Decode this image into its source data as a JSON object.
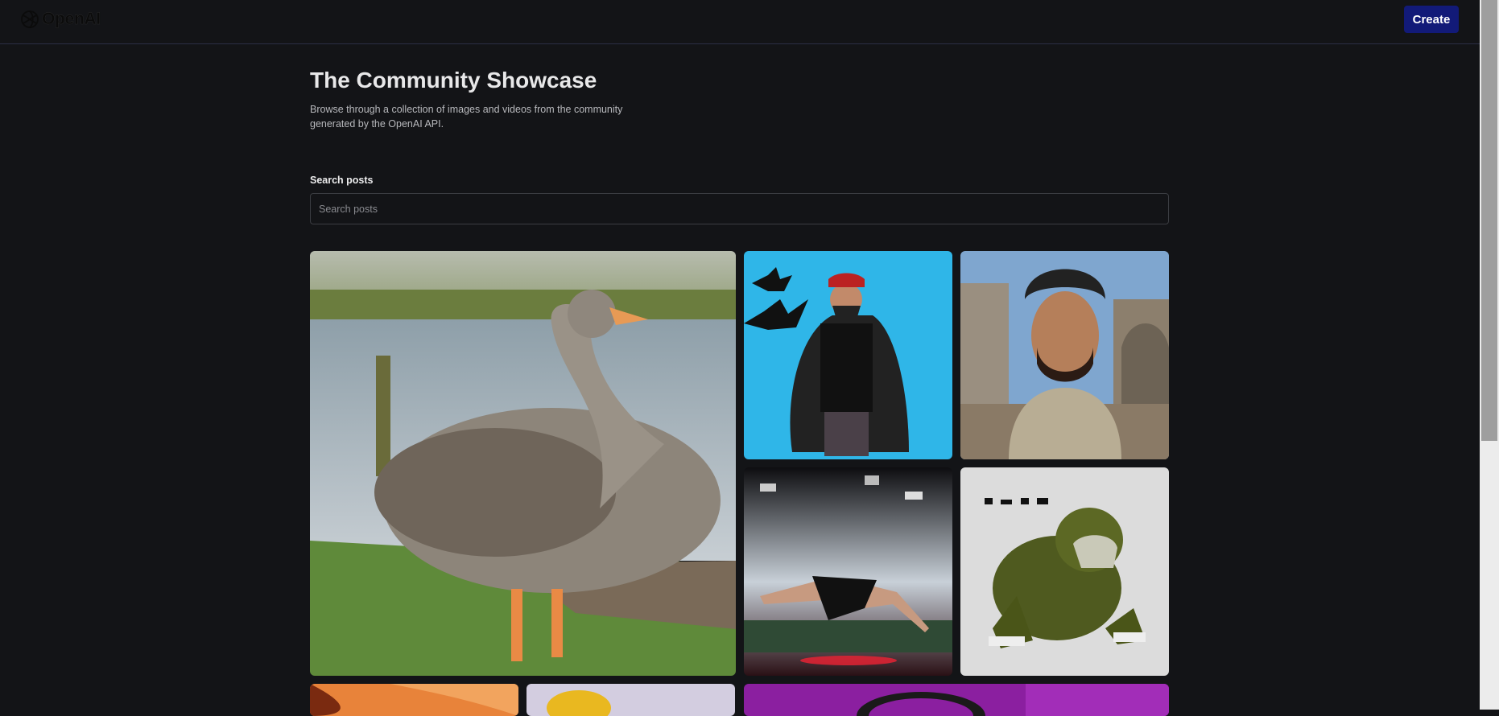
{
  "header": {
    "logo_text": "OpenAI",
    "logo_icon": "openai-logo-icon",
    "create_label": "Create"
  },
  "hero": {
    "title": "The Community Showcase",
    "subtitle": "Browse through a collection of images and videos from the community generated by the OpenAI API."
  },
  "search": {
    "label": "Search posts",
    "placeholder": "Search posts",
    "value": ""
  },
  "gallery": {
    "items": [
      {
        "subject": "goose-by-lake"
      },
      {
        "subject": "man-with-cape-and-bats"
      },
      {
        "subject": "3d-bearded-man"
      },
      {
        "subject": "floating-woman-city"
      },
      {
        "subject": "3d-green-gorilla"
      },
      {
        "subject": "orange-abstract"
      },
      {
        "subject": "yellow-shape-lavender"
      },
      {
        "subject": "purple-room"
      }
    ]
  },
  "colors": {
    "background": "#131417",
    "create_button": "#121a78",
    "header_border": "#2b2e45"
  }
}
